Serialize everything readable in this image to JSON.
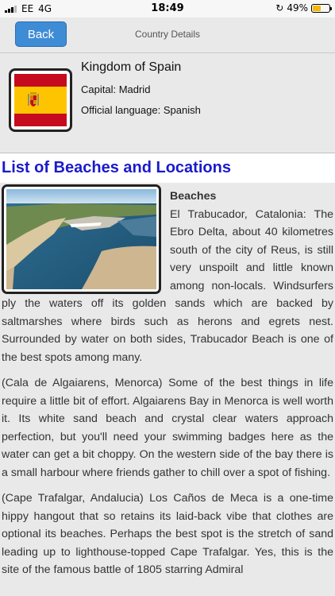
{
  "status_bar": {
    "carrier": "EE",
    "network": "4G",
    "time": "18:49",
    "battery": "49%",
    "battery_level": 0.49
  },
  "nav": {
    "back_label": "Back",
    "title": "Country Details"
  },
  "country": {
    "name": "Kingdom of Spain",
    "capital": "Capital: Madrid",
    "language": "Official language: Spanish"
  },
  "beaches": {
    "section_title": "List of Beaches and Locations",
    "heading": "Beaches",
    "paragraph1": "El Trabucador, Catalonia: The Ebro Delta, about 40 kilometres south of the city of Reus, is still very unspoilt and little known among non-locals. Windsurfers ply the waters off its golden sands which are backed by saltmarshes where birds such as herons and egrets nest. Surrounded by water on both sides, Trabucador Beach is one of the best spots among many.",
    "paragraph2": "(Cala de Algaiarens, Menorca) Some of the best things in life require a little bit of effort. Algaiarens Bay in Menorca is well worth it. Its white sand beach and crystal clear waters approach perfection, but you'll need your swimming badges here as the water can get a bit choppy. On the western side of the bay there is a small harbour where friends gather to chill over a spot of fishing.",
    "paragraph3": "(Cape Trafalgar, Andalucia) Los Caños de Meca is a one-time hippy hangout that so retains its laid-back vibe that clothes are optional its beaches. Perhaps the best spot is the stretch of sand leading up to lighthouse-topped Cape Trafalgar. Yes, this is the site of the famous battle of 1805 starring Admiral"
  }
}
